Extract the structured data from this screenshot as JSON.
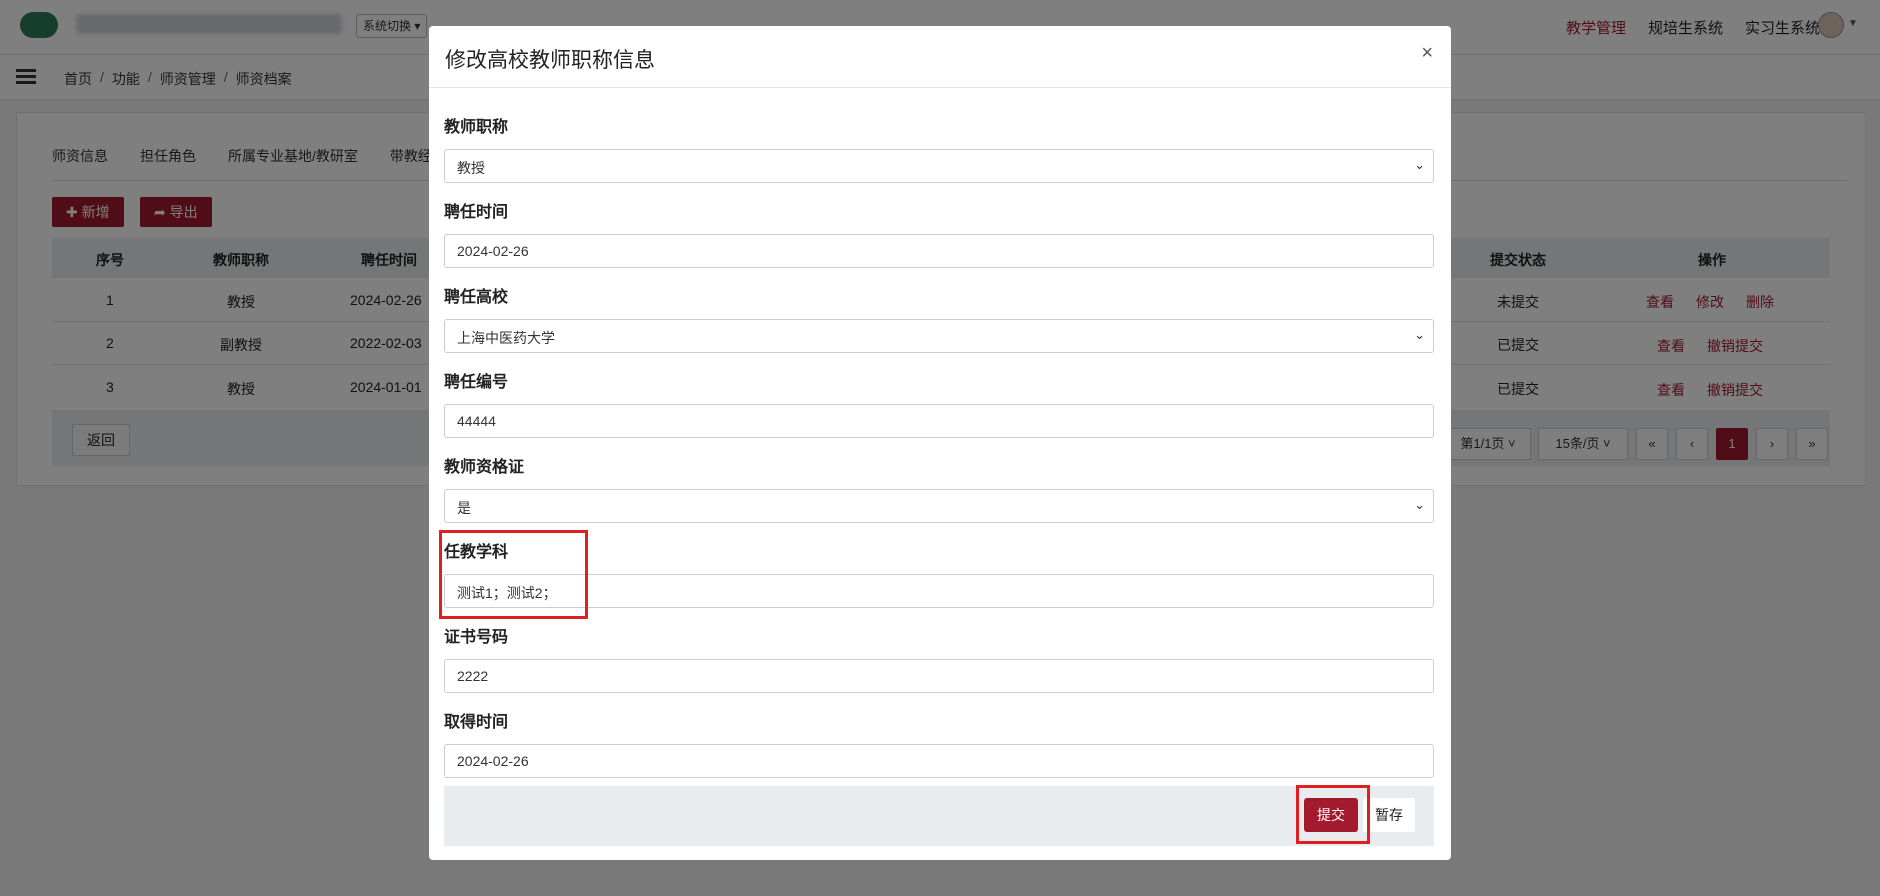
{
  "topbar": {
    "system_switch": "系统切换 ▾",
    "nav": [
      "教学管理",
      "规培生系统",
      "实习生系统"
    ]
  },
  "breadcrumb": [
    "首页",
    "功能",
    "师资管理",
    "师资档案"
  ],
  "tabs": [
    "师资信息",
    "担任角色",
    "所属专业基地/教研室",
    "带教经"
  ],
  "toolbar": {
    "add_label": "✚ 新增",
    "export_label": "➦ 导出"
  },
  "table": {
    "headers_left": [
      "序号",
      "教师职称",
      "聘任时间"
    ],
    "headers_right": [
      "提交状态",
      "操作"
    ],
    "rows": [
      {
        "index": "1",
        "title": "教授",
        "date": "2024-02-26",
        "status": "未提交",
        "actions": [
          "查看",
          "修改",
          "删除"
        ]
      },
      {
        "index": "2",
        "title": "副教授",
        "date": "2022-02-03",
        "status": "已提交",
        "actions": [
          "查看",
          "撤销提交"
        ]
      },
      {
        "index": "3",
        "title": "教授",
        "date": "2024-01-01",
        "status": "已提交",
        "actions": [
          "查看",
          "撤销提交"
        ]
      }
    ]
  },
  "footer": {
    "back_label": "返回",
    "page_info": "第1/1页 ˅",
    "page_size": "15条/页 ˅",
    "pager": [
      "«",
      "‹",
      "1",
      "›",
      "»"
    ]
  },
  "modal": {
    "title": "修改高校教师职称信息",
    "close": "×",
    "fields": [
      {
        "label": "教师职称",
        "value": "教授",
        "type": "select"
      },
      {
        "label": "聘任时间",
        "value": "2024-02-26",
        "type": "input"
      },
      {
        "label": "聘任高校",
        "value": "上海中医药大学",
        "type": "select"
      },
      {
        "label": "聘任编号",
        "value": "44444",
        "type": "input"
      },
      {
        "label": "教师资格证",
        "value": "是",
        "type": "select"
      },
      {
        "label": "任教学科",
        "value": "测试1；测试2；",
        "type": "input"
      },
      {
        "label": "证书号码",
        "value": "2222",
        "type": "input"
      },
      {
        "label": "取得时间",
        "value": "2024-02-26",
        "type": "input"
      }
    ],
    "submit_label": "提交",
    "draft_label": "暂存"
  },
  "colors": {
    "accent": "#a31a2e",
    "highlight": "#e02020"
  }
}
